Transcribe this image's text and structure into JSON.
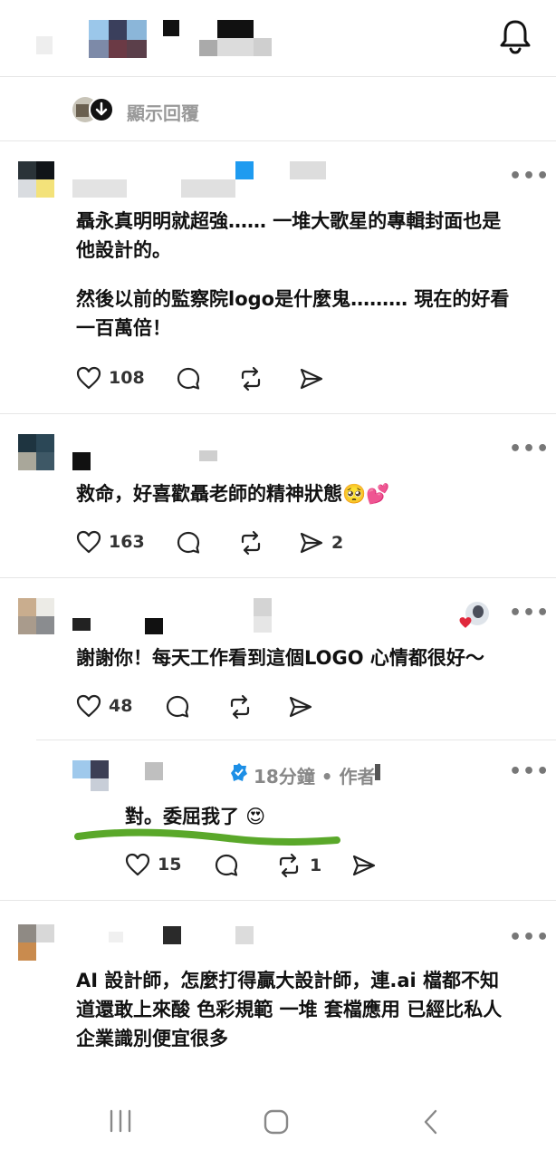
{
  "header": {
    "icon": "bell-icon"
  },
  "show_replies": {
    "label": "顯示回覆"
  },
  "posts": [
    {
      "lines": [
        "聶永真明明就超強…… 一堆大歌星的專輯封面也是",
        "他設計的。",
        "然後以前的監察院logo是什麼鬼……… 現在的好看",
        "一百萬倍！"
      ],
      "likes": "108"
    },
    {
      "lines": [
        "救命，好喜歡聶老師的精神狀態🥺💕"
      ],
      "likes": "163",
      "shares": "2"
    },
    {
      "lines": [
        "謝謝你！每天工作看到這個LOGO 心情都很好～"
      ],
      "likes": "48"
    },
    {
      "meta": "18分鐘 • 作者",
      "lines": [
        "對。委屈我了 😍"
      ],
      "likes": "15",
      "reposts": "1"
    },
    {
      "lines": [
        "AI 設計師，怎麼打得贏大設計師，連.ai 檔都不知",
        "道還敢上來酸 色彩規範 一堆 套檔應用 已經比私人",
        "企業識別便宜很多"
      ]
    }
  ],
  "more_label": "•••",
  "colors": {
    "highlight": "#5aa82a",
    "verified": "#1d8fe6",
    "heart": "#e0283c"
  }
}
